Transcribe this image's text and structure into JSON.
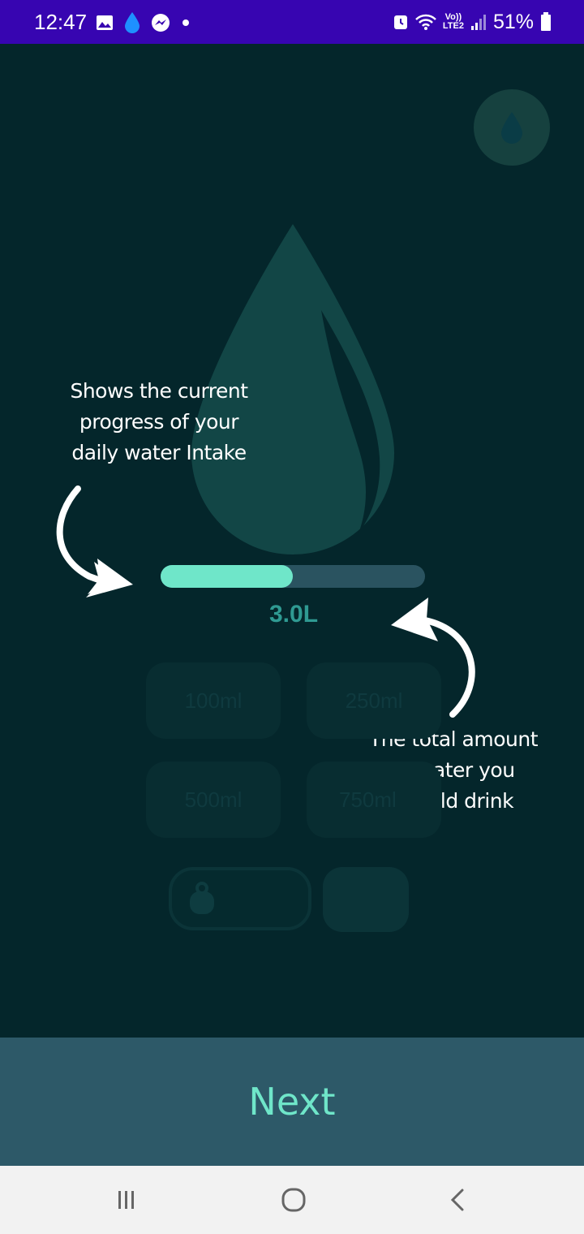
{
  "status_bar": {
    "time": "12:47",
    "left_icons": [
      "image-icon",
      "water-drop-icon",
      "messenger-icon",
      "dot-icon"
    ],
    "right_icons": [
      "alarm-icon",
      "wifi-icon",
      "volte-lte2-icon",
      "signal-icon",
      "battery-icon"
    ],
    "lte_line1": "Vo))",
    "lte_line2": "LTE2",
    "battery_percent": "51%",
    "bar_color": "#3705b1"
  },
  "app": {
    "background_color": "#04262b",
    "top_button_icon": "water-drop-icon",
    "hero_icon": "water-drop-icon",
    "progress": {
      "fraction": 0.5,
      "fill_color": "#6fe6c9",
      "track_color": "#2a5360"
    },
    "total_amount": "3.0L",
    "amount_buttons": [
      "100ml",
      "250ml",
      "500ml",
      "750ml"
    ],
    "custom_input_icon": "weight-icon"
  },
  "tips": {
    "progress_tip": "Shows the current\nprogress of your\ndaily water Intake",
    "total_tip": "The total amount\nof water you\nshould drink"
  },
  "footer": {
    "next_label": "Next",
    "bar_color": "#2d5968",
    "label_color": "#6fe6c9"
  },
  "navbar": {
    "items": [
      "recent-apps-icon",
      "home-icon",
      "back-icon"
    ]
  }
}
